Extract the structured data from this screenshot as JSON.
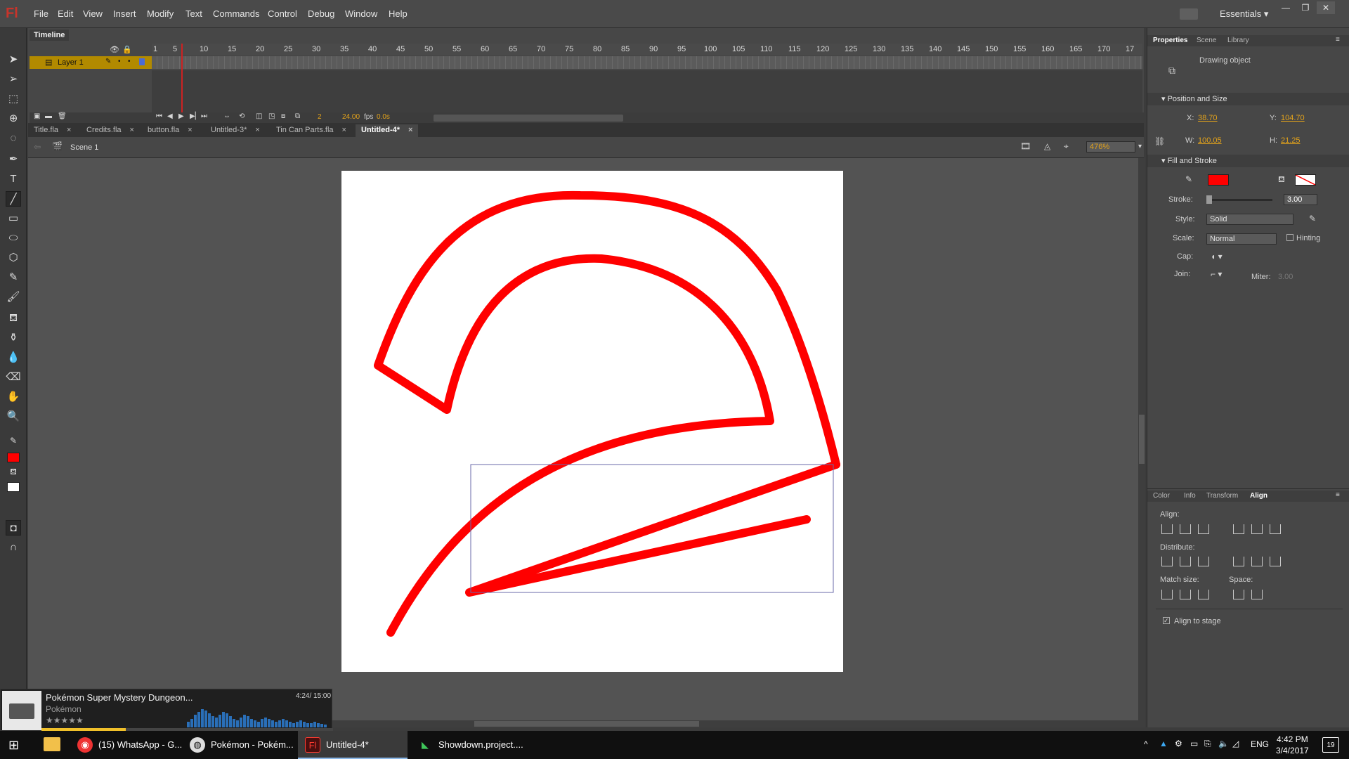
{
  "app": {
    "logo": "Fl"
  },
  "menu": [
    "File",
    "Edit",
    "View",
    "Insert",
    "Modify",
    "Text",
    "Commands",
    "Control",
    "Debug",
    "Window",
    "Help"
  ],
  "workspace": "Essentials",
  "timeline": {
    "tab": "Timeline",
    "frame_numbers": [
      "1",
      "5",
      "10",
      "15",
      "20",
      "25",
      "30",
      "35",
      "40",
      "45",
      "50",
      "55",
      "60",
      "65",
      "70",
      "75",
      "80",
      "85",
      "90",
      "95",
      "100",
      "105",
      "110",
      "115",
      "120",
      "125",
      "130",
      "135",
      "140",
      "145",
      "150",
      "155",
      "160",
      "165",
      "170",
      "17"
    ],
    "layer_name": "Layer 1",
    "current_frame": "2",
    "fps": "24.00",
    "fps_unit": "fps",
    "time": "0.0s"
  },
  "document_tabs": [
    {
      "label": "Title.fla",
      "active": false
    },
    {
      "label": "Credits.fla",
      "active": false
    },
    {
      "label": "button.fla",
      "active": false
    },
    {
      "label": "Untitled-3*",
      "active": false
    },
    {
      "label": "Tin Can Parts.fla",
      "active": false
    },
    {
      "label": "Untitled-4*",
      "active": true
    }
  ],
  "edit_bar": {
    "scene": "Scene 1",
    "zoom": "476%"
  },
  "properties": {
    "tabs": [
      "Properties",
      "Scene",
      "Library"
    ],
    "object_type": "Drawing object",
    "position_size": {
      "title": "Position and Size",
      "x_label": "X:",
      "x": "38.70",
      "y_label": "Y:",
      "y": "104.70",
      "w_label": "W:",
      "w": "100.05",
      "h_label": "H:",
      "h": "21.25"
    },
    "fill_stroke": {
      "title": "Fill and Stroke",
      "stroke_color": "#ff0000",
      "stroke_label": "Stroke:",
      "stroke_value": "3.00",
      "style_label": "Style:",
      "style_value": "Solid",
      "scale_label": "Scale:",
      "scale_value": "Normal",
      "hinting_label": "Hinting",
      "cap_label": "Cap:",
      "join_label": "Join:",
      "miter_label": "Miter:",
      "miter_value": "3.00"
    }
  },
  "align_panel": {
    "tabs": [
      "Color",
      "Info",
      "Transform",
      "Align"
    ],
    "align_label": "Align:",
    "distribute_label": "Distribute:",
    "match_size_label": "Match size:",
    "space_label": "Space:",
    "align_to_stage": "Align to stage"
  },
  "media": {
    "title": "Pokémon Super Mystery Dungeon...",
    "artist": "Pokémon",
    "rating": "★★★★★",
    "time": "4:24/ 15:00",
    "progress": 0.29
  },
  "taskbar": {
    "apps": [
      {
        "label": "(15) WhatsApp - G...",
        "icon": "chrome-icon"
      },
      {
        "label": "Pokémon - Pokém...",
        "icon": "media-player-icon"
      },
      {
        "label": "Untitled-4*",
        "icon": "flash-icon"
      },
      {
        "label": "Showdown.project....",
        "icon": "showdown-icon"
      }
    ],
    "language": "ENG",
    "time": "4:42 PM",
    "date": "3/4/2017",
    "notifications": "19"
  }
}
